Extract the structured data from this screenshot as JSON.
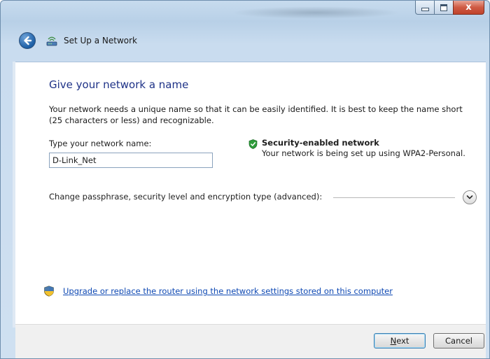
{
  "window": {
    "title": "Set Up a Network",
    "caption": {
      "minimize_icon": "minimize-icon",
      "maximize_icon": "maximize-icon",
      "close_glyph": "x"
    }
  },
  "nav": {
    "back_icon": "back-arrow-icon",
    "wizard_icon": "network-setup-icon"
  },
  "page": {
    "heading": "Give your network a name",
    "description": "Your network needs a unique name so that it can be easily identified. It is best to keep the name short (25 characters or less) and recognizable.",
    "name_label": "Type your network name:",
    "name_value": "D-Link_Net",
    "security": {
      "icon": "shield-check-icon",
      "title": "Security-enabled network",
      "subtitle": "Your network is being set up using WPA2-Personal."
    },
    "advanced_label": "Change passphrase, security level and encryption type (advanced):",
    "expand_icon": "chevron-down-icon",
    "upgrade_icon": "uac-shield-icon",
    "upgrade_link": "Upgrade or replace the router using the network settings stored on this computer"
  },
  "footer": {
    "next_label_access": "N",
    "next_label_rest": "ext",
    "cancel_label": "Cancel"
  },
  "colors": {
    "heading": "#1e3287",
    "link": "#0f49b3",
    "security_ok": "#2e9b3a"
  }
}
